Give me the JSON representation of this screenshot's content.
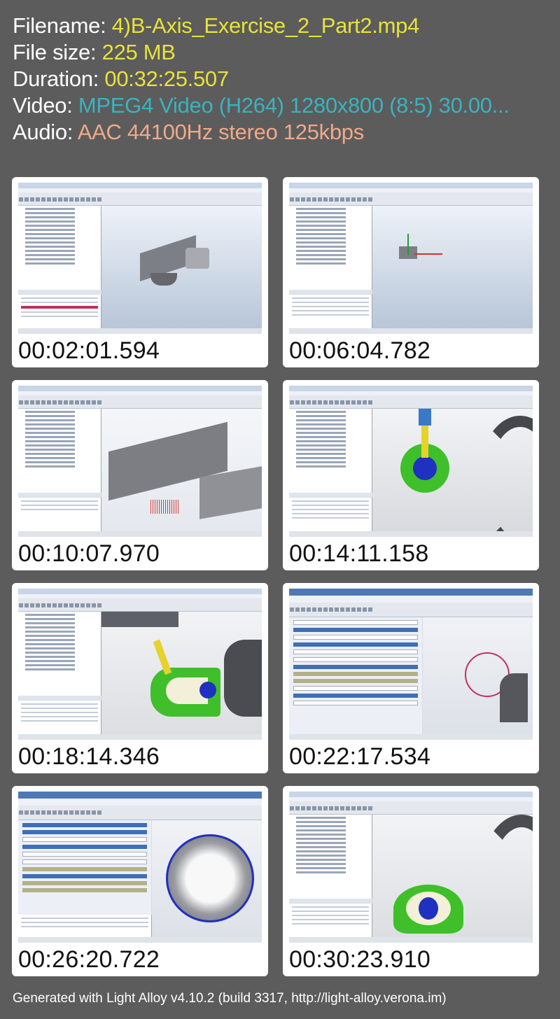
{
  "info": {
    "filename_label": "Filename: ",
    "filename_value": "4)B-Axis_Exercise_2_Part2.mp4",
    "filesize_label": "File size: ",
    "filesize_value": "225 MB",
    "duration_label": "Duration: ",
    "duration_value": "00:32:25.507",
    "video_label": "Video: ",
    "video_value": "MPEG4 Video (H264) 1280x800 (8:5) 30.00...",
    "audio_label": "Audio: ",
    "audio_value": "AAC 44100Hz stereo 125kbps"
  },
  "colors": {
    "filename": "#e8e23a",
    "video": "#38b4c0",
    "audio": "#f0a98a",
    "background": "#5c5c5c"
  },
  "thumbnails": [
    {
      "timestamp": "00:02:01.594"
    },
    {
      "timestamp": "00:06:04.782"
    },
    {
      "timestamp": "00:10:07.970"
    },
    {
      "timestamp": "00:14:11.158"
    },
    {
      "timestamp": "00:18:14.346"
    },
    {
      "timestamp": "00:22:17.534"
    },
    {
      "timestamp": "00:26:20.722"
    },
    {
      "timestamp": "00:30:23.910"
    }
  ],
  "footer": "Generated with Light Alloy v4.10.2 (build 3317, http://light-alloy.verona.im)"
}
